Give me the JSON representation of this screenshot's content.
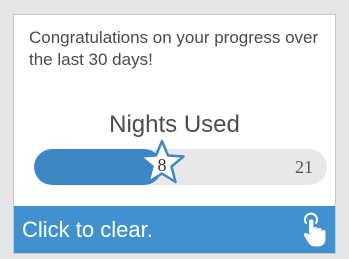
{
  "card": {
    "message": "Congratulations on your progress over the last 30 days!",
    "metric_title": "Nights Used",
    "progress": {
      "value": "8",
      "max": "21"
    },
    "footer": {
      "label": "Click to clear.",
      "icon": "hand-pointer-icon"
    }
  },
  "colors": {
    "fill": "#3d88c4",
    "track": "#e8e8e8",
    "footer": "#4291cf",
    "text": "#4a4a4a"
  }
}
